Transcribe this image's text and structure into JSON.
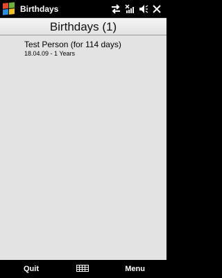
{
  "window": {
    "title": "Birthdays"
  },
  "header": {
    "title": "Birthdays (1)"
  },
  "list": {
    "items": [
      {
        "title": "Test Person  (for 114 days)",
        "detail": "18.04.09 - 1 Years"
      }
    ]
  },
  "softkeys": {
    "left_label": "Quit",
    "right_label": "Menu"
  },
  "icons": {
    "start": "windows-flag-icon",
    "status": [
      "connectivity-arrows-icon",
      "signal-off-icon",
      "speaker-icon",
      "close-icon"
    ],
    "softkey_center": "keyboard-icon"
  },
  "colors": {
    "titlebar": "#000000",
    "content_bg": "#e3e3e3",
    "text": "#000000",
    "softbar": "#000000"
  }
}
